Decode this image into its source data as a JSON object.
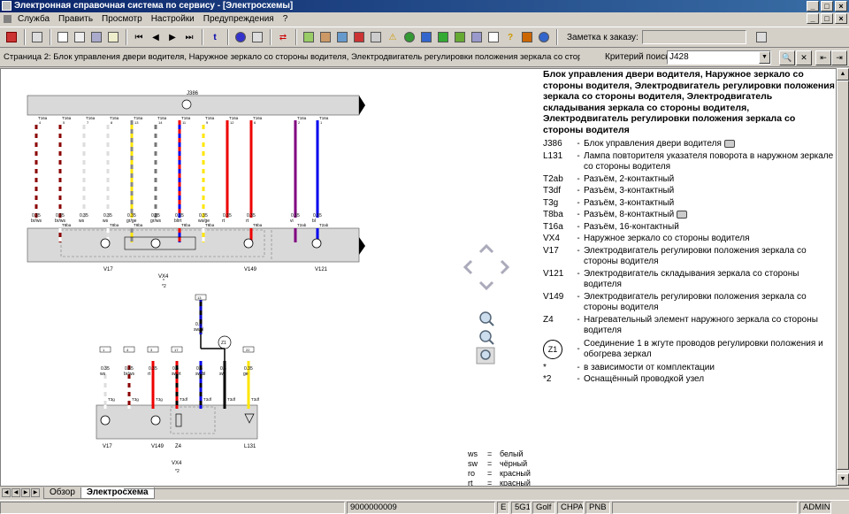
{
  "window": {
    "title": "Электронная справочная система по сервису - [Электросхемы]",
    "btn_min": "_",
    "btn_max": "□",
    "btn_close": "×"
  },
  "menu": {
    "items": [
      "Служба",
      "Править",
      "Просмотр",
      "Настройки",
      "Предупреждения",
      "?"
    ]
  },
  "toolbar": {
    "order_label": "Заметка к заказу:",
    "order_value": ""
  },
  "infobar": {
    "page_text": "Страница 2: Блок управления двери водителя, Наружное зеркало со стороны водителя, Электродвигатель регулировки положения зеркала со стороны водителя,",
    "criteria_label": "Критерий поиска:",
    "criteria_value": "J428"
  },
  "description": {
    "title": "Блок управления двери водителя, Наружное зеркало со стороны водителя, Электродвигатель регулировки положения зеркала со стороны водителя, Электродвигатель складывания зеркала со стороны водителя, Электродвигатель регулировки положения зеркала со стороны водителя",
    "legend": [
      {
        "code": "J386",
        "text": "Блок управления двери водителя",
        "cam": true
      },
      {
        "code": "L131",
        "text": "Лампа повторителя указателя поворота в наружном зеркале со стороны водителя",
        "cam": false
      },
      {
        "code": "T2ab",
        "text": "Разъём, 2-контактный",
        "cam": false
      },
      {
        "code": "T3df",
        "text": "Разъём, 3-контактный",
        "cam": false
      },
      {
        "code": "T3g",
        "text": "Разъём, 3-контактный",
        "cam": false
      },
      {
        "code": "T8ba",
        "text": "Разъём, 8-контактный",
        "cam": true
      },
      {
        "code": "T16a",
        "text": "Разъём, 16-контактный",
        "cam": false
      },
      {
        "code": "VX4",
        "text": "Наружное зеркало со стороны водителя",
        "cam": false
      },
      {
        "code": "V17",
        "text": "Электродвигатель регулировки положения зеркала со стороны водителя",
        "cam": false
      },
      {
        "code": "V121",
        "text": "Электродвигатель складывания зеркала со стороны водителя",
        "cam": false
      },
      {
        "code": "V149",
        "text": "Электродвигатель регулировки положения зеркала со стороны водителя",
        "cam": false
      },
      {
        "code": "Z4",
        "text": "Нагревательный элемент наружного зеркала со стороны водителя",
        "cam": false
      }
    ],
    "z1": {
      "code": "Z1",
      "text": "Соединение 1 в жгуте проводов регулировки положения и обогрева зеркал"
    },
    "notes": [
      {
        "code": "*",
        "text": "в зависимости от комплектации"
      },
      {
        "code": "*2",
        "text": "Оснащённый проводкой узел"
      }
    ]
  },
  "colors_legend": [
    {
      "code": "ws",
      "eq": "=",
      "name": "белый"
    },
    {
      "code": "sw",
      "eq": "=",
      "name": "чёрный"
    },
    {
      "code": "ro",
      "eq": "=",
      "name": "красный"
    },
    {
      "code": "rt",
      "eq": "=",
      "name": "красный"
    }
  ],
  "diagram": {
    "top_unit": "J386",
    "top_pins": [
      {
        "conn": "T16a",
        "pin": "4",
        "gauge": "0.35",
        "color": "br/ws"
      },
      {
        "conn": "T16a",
        "pin": "5",
        "gauge": "0.35",
        "color": "br/ws"
      },
      {
        "conn": "T16a",
        "pin": "7",
        "gauge": "0.35",
        "color": "ws"
      },
      {
        "conn": "T16a",
        "pin": "8",
        "gauge": "0.35",
        "color": "ws"
      },
      {
        "conn": "T16a",
        "pin": "13",
        "gauge": "0.35",
        "color": "gr/ge"
      },
      {
        "conn": "T16a",
        "pin": "14",
        "gauge": "0.35",
        "color": "gr/ws"
      },
      {
        "conn": "T16a",
        "pin": "11",
        "gauge": "0.35",
        "color": "bl/rt"
      },
      {
        "conn": "T16a",
        "pin": "9",
        "gauge": "0.35",
        "color": "ws/ge"
      },
      {
        "conn": "T16a",
        "pin": "12",
        "gauge": "0.35",
        "color": "rt"
      },
      {
        "conn": "T16a",
        "pin": "6",
        "gauge": "0.35",
        "color": "rt"
      },
      {
        "conn": "T16a",
        "pin": "2",
        "gauge": "0.35",
        "color": "vi"
      },
      {
        "conn": "T16a",
        "pin": "1",
        "gauge": "0.35",
        "color": "bl"
      }
    ],
    "mid_connectors": [
      "T8ba",
      "T8ba",
      "T8ba",
      "T8ba",
      "T8ba",
      "T8ba",
      "T2ab",
      "T2ab"
    ],
    "top_components": [
      "V17",
      "V149",
      "V121"
    ],
    "vx4": "VX4",
    "star": "*",
    "star2": "*2",
    "bottom_pins": [
      {
        "box": "1",
        "gauge": "0.35",
        "color": "ws",
        "conn": "T3g"
      },
      {
        "box": "4",
        "gauge": "0.35",
        "color": "br/ws",
        "conn": "T3g"
      },
      {
        "box": "3",
        "gauge": "0.35",
        "color": "rt",
        "conn": "T3g"
      },
      {
        "box": "17",
        "gauge": "0.5",
        "color": "sw/rt",
        "conn": "T3df"
      },
      {
        "box": "",
        "gauge": "0.5",
        "color": "sw/bl",
        "conn": "T3df"
      },
      {
        "box": "",
        "gauge": "0.5",
        "color": "sw",
        "conn": "T3df"
      },
      {
        "box": "22",
        "gauge": "0.35",
        "color": "ge",
        "conn": "T3df"
      }
    ],
    "z1_gauge": "0.5",
    "z1_color": "sw/bl",
    "z1_box": "13",
    "z1_label": "Z1",
    "bottom_components": [
      "V17",
      "V149",
      "Z4",
      "L131"
    ],
    "vx4_bottom": "VX4",
    "star2_bottom": "*2"
  },
  "tabs": [
    "Обзор",
    "Электросхема"
  ],
  "status": [
    "",
    "9000000009",
    "E",
    "5G1",
    "Golf",
    "CHPA",
    "PNB",
    "",
    "ADMIN"
  ]
}
